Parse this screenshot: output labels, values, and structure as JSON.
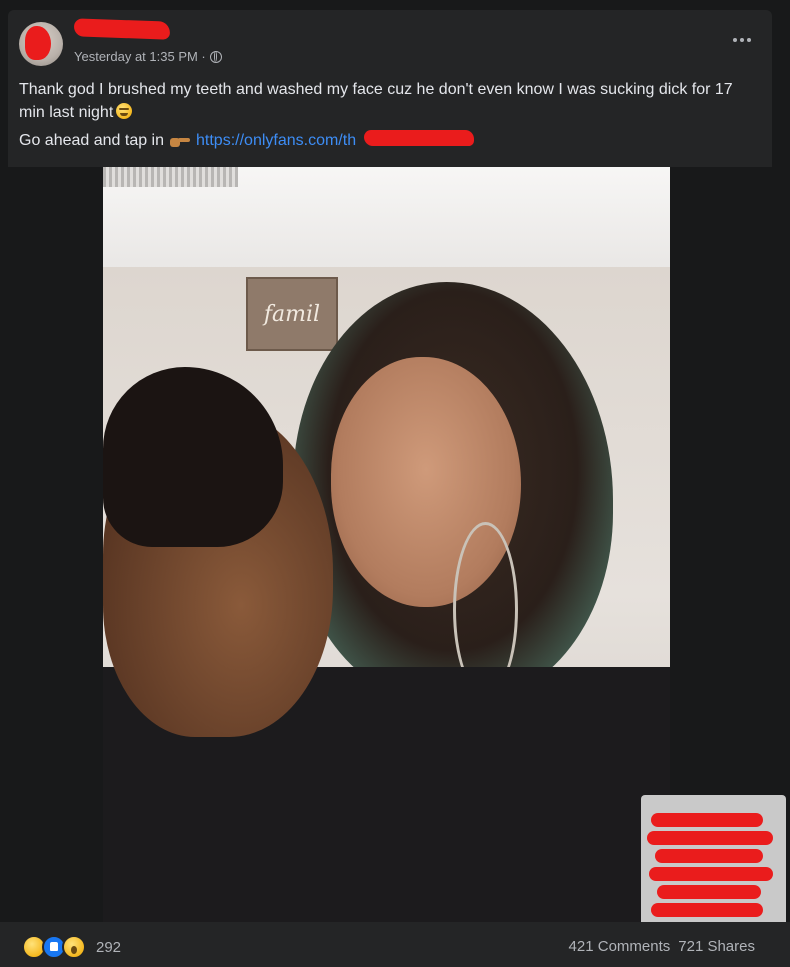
{
  "post": {
    "author": {
      "name": "",
      "avatar_redacted": true
    },
    "timestamp": "Yesterday at 1:35 PM ·",
    "privacy_icon": "globe-icon",
    "text_line": "Thank god I brushed my teeth and washed my face cuz he don't even know I was sucking dick for 17 min last night",
    "text_emoji": "grimacing-face-emoji",
    "cta_text": "Go ahead and tap in",
    "cta_icon": "pointing-right-icon",
    "link_text": "https://onlyfans.com/th",
    "more_icon": "more-options-icon"
  },
  "photo": {
    "sign_text": "famil"
  },
  "footer": {
    "reaction_icons": [
      "haha-icon",
      "like-icon",
      "wow-icon"
    ],
    "reaction_count": "292",
    "comments": "421 Comments",
    "shares": "721 Shares"
  },
  "colors": {
    "background": "#18191a",
    "card": "#242526",
    "text_primary": "#e4e6eb",
    "text_secondary": "#b0b3b8",
    "link": "#3d8df5",
    "redaction": "#ea1c1c"
  }
}
